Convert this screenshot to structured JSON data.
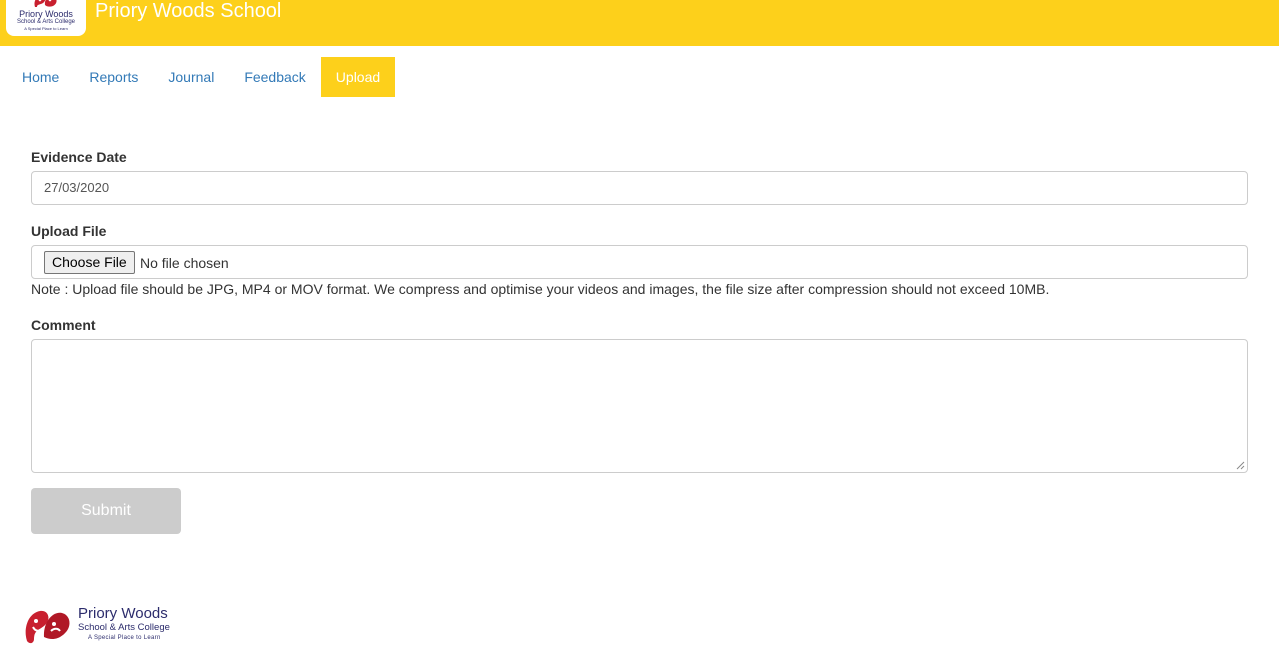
{
  "header": {
    "title": "Priory Woods School",
    "logo": {
      "name": "Priory Woods",
      "subtitle": "School & Arts College",
      "tagline": "A Special Place to Learn"
    },
    "colors": {
      "brand_yellow": "#fdd01b",
      "logo_red": "#c8202f",
      "logo_navy": "#2c2c6c"
    }
  },
  "nav": {
    "tabs": [
      {
        "label": "Home",
        "active": false
      },
      {
        "label": "Reports",
        "active": false
      },
      {
        "label": "Journal",
        "active": false
      },
      {
        "label": "Feedback",
        "active": false
      },
      {
        "label": "Upload",
        "active": true
      }
    ],
    "link_color": "#337ab7"
  },
  "form": {
    "evidence_date": {
      "label": "Evidence Date",
      "value": "27/03/2020"
    },
    "upload_file": {
      "label": "Upload File",
      "button_label": "Choose File",
      "status": "No file chosen",
      "note": "Note : Upload file should be JPG, MP4 or MOV format. We compress and optimise your videos and images, the file size after compression should not exceed 10MB."
    },
    "comment": {
      "label": "Comment",
      "value": ""
    },
    "submit": {
      "label": "Submit",
      "disabled": true
    }
  },
  "footer": {
    "logo": {
      "name": "Priory  Woods",
      "subtitle": "School & Arts College",
      "tagline": "A Special Place to Learn"
    }
  }
}
